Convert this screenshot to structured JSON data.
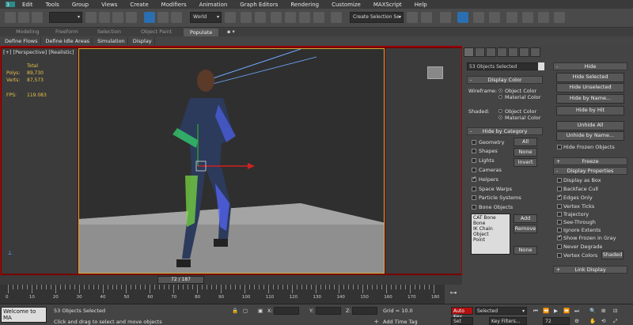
{
  "menu": [
    "Edit",
    "Tools",
    "Group",
    "Views",
    "Create",
    "Modifiers",
    "Animation",
    "Graph Editors",
    "Rendering",
    "Customize",
    "MAXScript",
    "Help"
  ],
  "toolbar": {
    "refcoord": "World",
    "named_selection": "Create Selection Se",
    "filter": ""
  },
  "ribbon_tabs": [
    "Modeling",
    "Freeform",
    "Selection",
    "Object Paint",
    "Populate"
  ],
  "ribbon_active": "Populate",
  "subtabs": [
    "Define Flows",
    "Define Idle Areas",
    "Simulation",
    "Display"
  ],
  "viewport": {
    "label": "[+] [Perspective] [Realistic]",
    "stats": {
      "total_label": "Total",
      "polys_label": "Polys:",
      "polys": "89,730",
      "verts_label": "Verts:",
      "verts": "87,573",
      "fps_label": "FPS:",
      "fps": "119.083"
    },
    "colors": {
      "border_active": "#c9b13a",
      "frame": "#7a0000"
    }
  },
  "cmd_panel": {
    "name_field": "53 Objects Selected",
    "display_color": {
      "title": "Display Color",
      "wireframe_label": "Wireframe:",
      "shaded_label": "Shaded:",
      "object_color": "Object Color",
      "material_color": "Material Color"
    },
    "hide_by_category": {
      "title": "Hide by Category",
      "items": [
        {
          "label": "Geometry",
          "checked": false
        },
        {
          "label": "Shapes",
          "checked": false
        },
        {
          "label": "Lights",
          "checked": false
        },
        {
          "label": "Cameras",
          "checked": false
        },
        {
          "label": "Helpers",
          "checked": true
        },
        {
          "label": "Space Warps",
          "checked": false
        },
        {
          "label": "Particle Systems",
          "checked": false
        },
        {
          "label": "Bone Objects",
          "checked": false
        }
      ],
      "buttons": [
        "All",
        "None",
        "Invert"
      ],
      "list": [
        "CAT Bone",
        "Bone",
        "IK Chain Object",
        "Point"
      ],
      "add": "Add",
      "remove": "Remove",
      "none2": "None"
    }
  },
  "cmd_panel2": {
    "hide_title": "Hide",
    "hide_buttons": [
      "Hide Selected",
      "Hide Unselected",
      "Hide by Name...",
      "Hide by Hit"
    ],
    "unhide_buttons": [
      "Unhide All",
      "Unhide by Name..."
    ],
    "hide_frozen": "Hide Frozen Objects",
    "freeze_title": "Freeze",
    "display_props_title": "Display Properties",
    "props": [
      {
        "label": "Display as Box",
        "checked": false
      },
      {
        "label": "Backface Cull",
        "checked": false
      },
      {
        "label": "Edges Only",
        "checked": true
      },
      {
        "label": "Vertex Ticks",
        "checked": false
      },
      {
        "label": "Trajectory",
        "checked": false
      },
      {
        "label": "See-Through",
        "checked": false
      },
      {
        "label": "Ignore Extents",
        "checked": false
      },
      {
        "label": "Show Frozen in Gray",
        "checked": true
      },
      {
        "label": "Never Degrade",
        "checked": false
      },
      {
        "label": "Vertex Colors",
        "checked": false
      }
    ],
    "shaded_btn": "Shaded",
    "link_display_title": "Link Display"
  },
  "timeline": {
    "slider": "72 / 187",
    "ticks": [
      "0",
      "10",
      "20",
      "30",
      "40",
      "50",
      "60",
      "70",
      "80",
      "90",
      "100",
      "110",
      "120",
      "130",
      "140",
      "150",
      "160",
      "170",
      "180"
    ]
  },
  "status": {
    "script_listener": "Welcome to MA",
    "selection": "53 Objects Selected",
    "prompt": "Click and drag to select and move objects",
    "x_label": "X:",
    "y_label": "Y:",
    "z_label": "Z:",
    "grid": "Grid = 10.0",
    "add_time_tag": "Add Time Tag",
    "auto_key": "Auto Key",
    "set_key": "Set Key",
    "key_filters": "Key Filters...",
    "selected": "Selected",
    "frame": "72"
  }
}
